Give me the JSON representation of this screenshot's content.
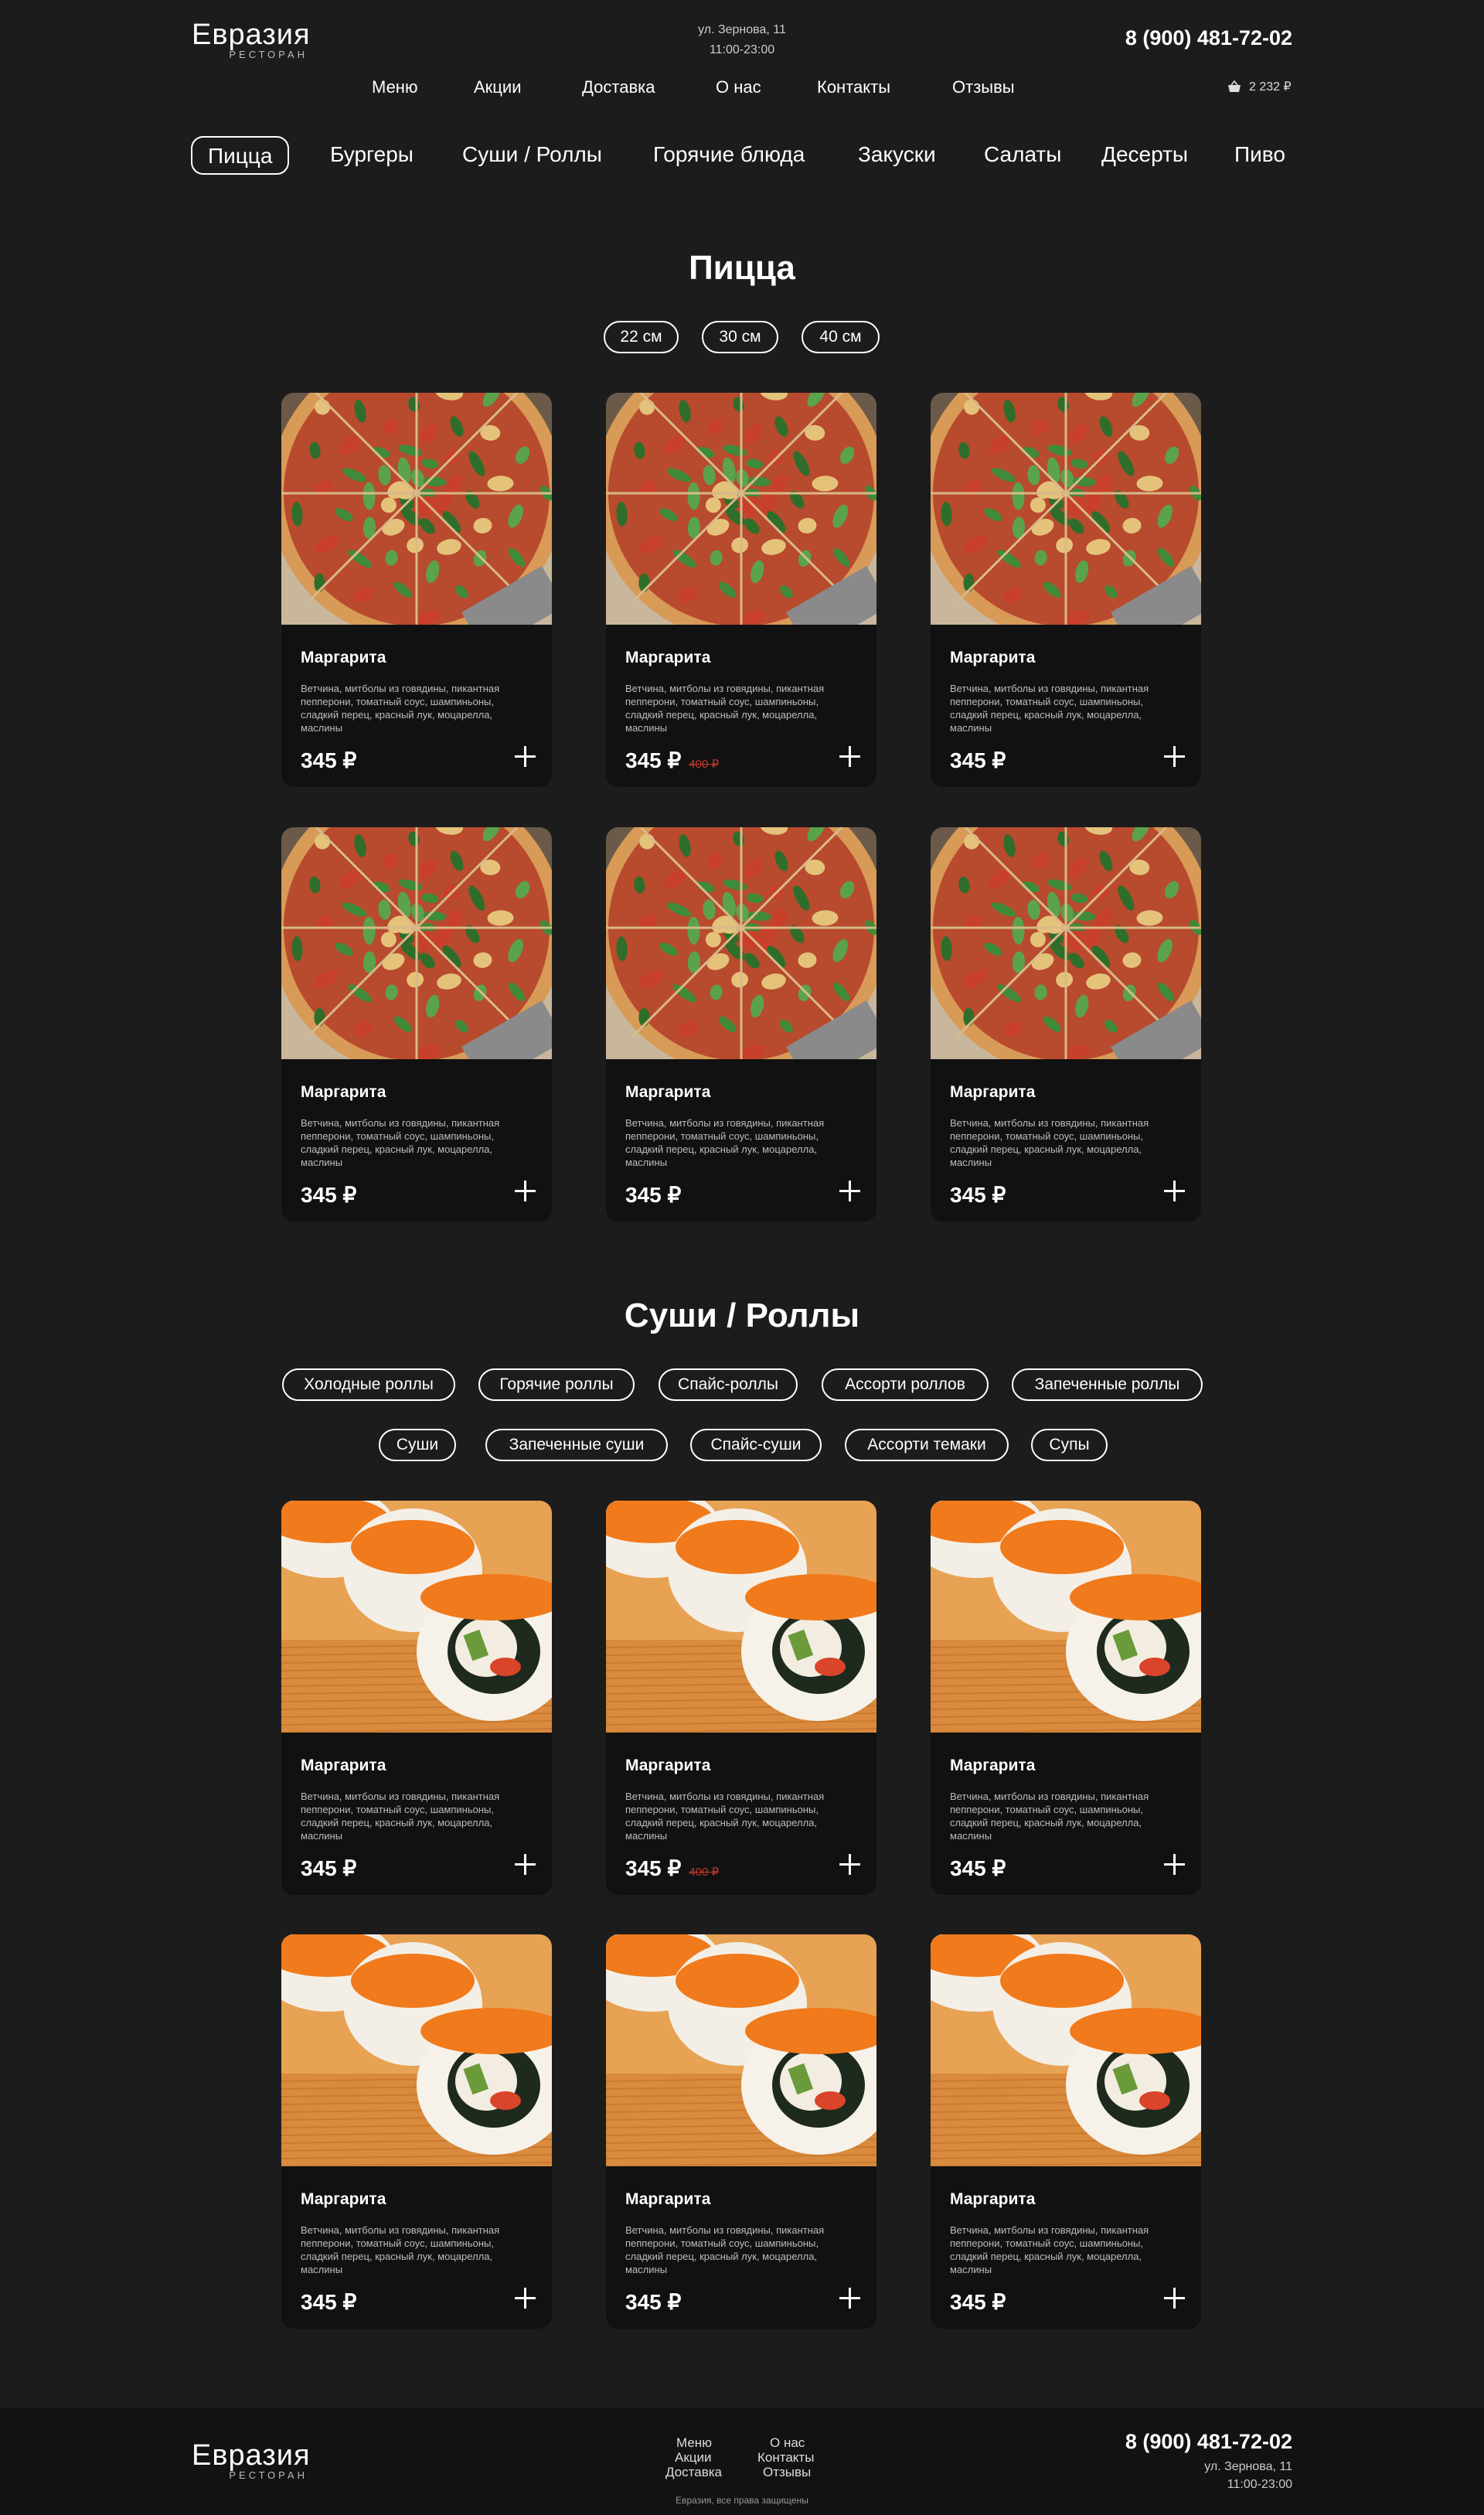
{
  "header": {
    "logo_title": "Евразия",
    "logo_sub": "РЕСТОРАН",
    "address": "ул. Зернова, 11",
    "hours": "11:00-23:00",
    "phone": "8 (900) 481-72-02",
    "cart_total": "2 232 ₽",
    "cart_icon": "basket-icon",
    "nav": [
      "Меню",
      "Акции",
      "Доставка",
      "О нас",
      "Контакты",
      "Отзывы"
    ]
  },
  "categories": [
    "Пицца",
    "Бургеры",
    "Суши / Роллы",
    "Горячие блюда",
    "Закуски",
    "Салаты",
    "Десерты",
    "Пиво"
  ],
  "pizza": {
    "title": "Пицца",
    "sizes": [
      "22 см",
      "30 см",
      "40 см"
    ],
    "products": [
      {
        "name": "Маргарита",
        "desc": "Ветчина, митболы из говядины, пикантная пепперони, томатный соус, шампиньоны, сладкий перец, красный лук, моцарелла, маслины",
        "price": "345 ₽",
        "old_price": ""
      },
      {
        "name": "Маргарита",
        "desc": "Ветчина, митболы из говядины, пикантная пепперони, томатный соус, шампиньоны, сладкий перец, красный лук, моцарелла, маслины",
        "price": "345 ₽",
        "old_price": "400 ₽"
      },
      {
        "name": "Маргарита",
        "desc": "Ветчина, митболы из говядины, пикантная пепперони, томатный соус, шампиньоны, сладкий перец, красный лук, моцарелла, маслины",
        "price": "345 ₽",
        "old_price": ""
      },
      {
        "name": "Маргарита",
        "desc": "Ветчина, митболы из говядины, пикантная пепперони, томатный соус, шампиньоны, сладкий перец, красный лук, моцарелла, маслины",
        "price": "345 ₽",
        "old_price": ""
      },
      {
        "name": "Маргарита",
        "desc": "Ветчина, митболы из говядины, пикантная пепперони, томатный соус, шампиньоны, сладкий перец, красный лук, моцарелла, маслины",
        "price": "345 ₽",
        "old_price": ""
      },
      {
        "name": "Маргарита",
        "desc": "Ветчина, митболы из говядины, пикантная пепперони, томатный соус, шампиньоны, сладкий перец, красный лук, моцарелла, маслины",
        "price": "345 ₽",
        "old_price": ""
      }
    ]
  },
  "sushi": {
    "title": "Суши / Роллы",
    "filters": [
      "Холодные роллы",
      "Горячие роллы",
      "Спайс-роллы",
      "Ассорти роллов",
      "Запеченные роллы",
      "Суши",
      "Запеченные суши",
      "Спайс-суши",
      "Ассорти темаки",
      "Супы"
    ],
    "products": [
      {
        "name": "Маргарита",
        "desc": "Ветчина, митболы из говядины, пикантная пепперони, томатный соус, шампиньоны, сладкий перец, красный лук, моцарелла, маслины",
        "price": "345 ₽",
        "old_price": ""
      },
      {
        "name": "Маргарита",
        "desc": "Ветчина, митболы из говядины, пикантная пепперони, томатный соус, шампиньоны, сладкий перец, красный лук, моцарелла, маслины",
        "price": "345 ₽",
        "old_price": "400 ₽"
      },
      {
        "name": "Маргарита",
        "desc": "Ветчина, митболы из говядины, пикантная пепперони, томатный соус, шампиньоны, сладкий перец, красный лук, моцарелла, маслины",
        "price": "345 ₽",
        "old_price": ""
      },
      {
        "name": "Маргарита",
        "desc": "Ветчина, митболы из говядины, пикантная пепперони, томатный соус, шампиньоны, сладкий перец, красный лук, моцарелла, маслины",
        "price": "345 ₽",
        "old_price": ""
      },
      {
        "name": "Маргарита",
        "desc": "Ветчина, митболы из говядины, пикантная пепперони, томатный соус, шампиньоны, сладкий перец, красный лук, моцарелла, маслины",
        "price": "345 ₽",
        "old_price": ""
      },
      {
        "name": "Маргарита",
        "desc": "Ветчина, митболы из говядины, пикантная пепперони, томатный соус, шампиньоны, сладкий перец, красный лук, моцарелла, маслины",
        "price": "345 ₽",
        "old_price": ""
      }
    ]
  },
  "footer": {
    "logo_title": "Евразия",
    "logo_sub": "РЕСТОРАН",
    "links": [
      "Меню",
      "Акции",
      "Доставка",
      "О нас",
      "Контакты",
      "Отзывы"
    ],
    "phone": "8 (900) 481-72-02",
    "address": "ул. Зернова, 11",
    "hours": "11:00-23:00",
    "copyright": "Евразия, все права защищены"
  },
  "colors": {
    "background": "#1c1c1c",
    "card": "#111111",
    "old_price": "#c0392b"
  }
}
